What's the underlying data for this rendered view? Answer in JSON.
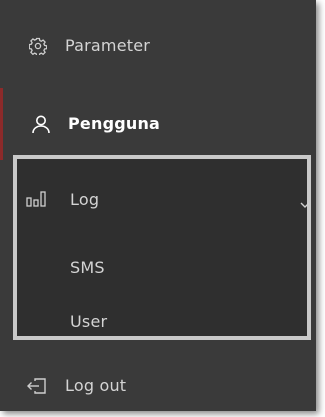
{
  "menu": {
    "parameter": {
      "label": "Parameter",
      "icon": "gear-icon"
    },
    "pengguna": {
      "label": "Pengguna",
      "icon": "user-icon",
      "active": true
    },
    "log": {
      "label": "Log",
      "icon": "bar-chart-icon",
      "expanded": true,
      "children": [
        {
          "label": "SMS"
        },
        {
          "label": "User"
        }
      ]
    },
    "logout": {
      "label": "Log out",
      "icon": "logout-icon"
    }
  },
  "colors": {
    "background": "#3a3a3a",
    "text": "#d4d4d4",
    "active_text": "#ffffff",
    "accent": "#8c2a2a",
    "highlight_border": "#c9c9c9"
  }
}
